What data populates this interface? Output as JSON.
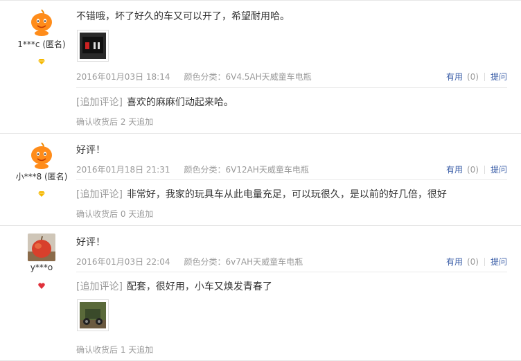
{
  "reviews": [
    {
      "user": "1***c (匿名)",
      "text": "不错哦，坏了好久的车又可以开了，希望耐用哈。",
      "date": "2016年01月03日 18:14",
      "sku": "颜色分类：6V4.5AH天威童车电瓶",
      "useful_label": "有用",
      "useful_count": "(0)",
      "ask_label": "提问",
      "append_tag": "[追加评论]",
      "append_text": "喜欢的麻麻们动起来哈。",
      "append_time": "确认收货后 2 天追加"
    },
    {
      "user": "小***8 (匿名)",
      "text": "好评！",
      "date": "2016年01月18日 21:31",
      "sku": "颜色分类：6V12AH天威童车电瓶",
      "useful_label": "有用",
      "useful_count": "(0)",
      "ask_label": "提问",
      "append_tag": "[追加评论]",
      "append_text": "非常好，我家的玩具车从此电量充足，可以玩很久，是以前的好几倍，很好",
      "append_time": "确认收货后 0 天追加"
    },
    {
      "user": "y***o",
      "text": "好评！",
      "date": "2016年01月03日 22:04",
      "sku": "颜色分类：6v7AH天威童车电瓶",
      "useful_label": "有用",
      "useful_count": "(0)",
      "ask_label": "提问",
      "append_tag": "[追加评论]",
      "append_text": "配套，很好用，小车又焕发青春了",
      "append_time": "确认收货后 1 天追加"
    }
  ],
  "colors": {
    "link": "#3c5fa8",
    "muted": "#999999",
    "text": "#333333",
    "level_gold": "#f5b800",
    "level_red": "#e0303a"
  }
}
